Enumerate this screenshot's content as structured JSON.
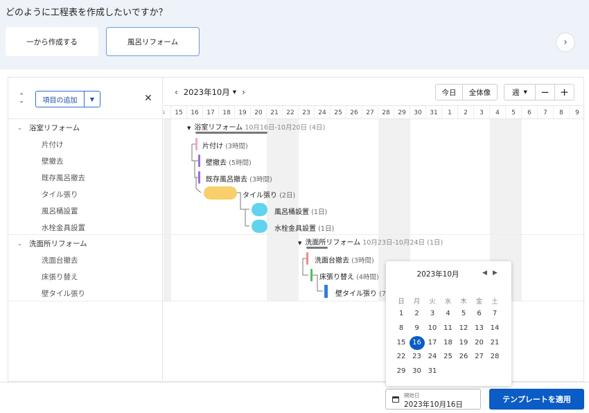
{
  "header": {
    "question": "どのように工程表を作成したいですか？",
    "templates": [
      {
        "label": "一から作成する"
      },
      {
        "label": "風呂リフォーム"
      }
    ],
    "next_icon": "chevron-right-icon"
  },
  "toolbar": {
    "add_item_label": "項目の追加",
    "month_label": "2023年10月",
    "today_label": "今日",
    "overview_label": "全体像",
    "scale_label": "週",
    "zoom_out": "−",
    "zoom_in": "+"
  },
  "days": [
    "4",
    "15",
    "16",
    "17",
    "18",
    "19",
    "20",
    "21",
    "22",
    "23",
    "24",
    "25",
    "26",
    "27",
    "28",
    "29",
    "30",
    "31",
    "1",
    "2",
    "3",
    "4",
    "5",
    "6",
    "7",
    "8",
    "9"
  ],
  "tasks": [
    {
      "name": "浴室リフォーム",
      "group": true
    },
    {
      "name": "片付け"
    },
    {
      "name": "壁撤去"
    },
    {
      "name": "既存風呂撤去"
    },
    {
      "name": "タイル張り"
    },
    {
      "name": "風呂桶設置"
    },
    {
      "name": "水栓金具設置"
    },
    {
      "name": "洗面所リフォーム",
      "group": true
    },
    {
      "name": "洗面台撤去"
    },
    {
      "name": "床張り替え"
    },
    {
      "name": "壁タイル張り"
    }
  ],
  "bars": [
    {
      "name": "浴室リフォーム",
      "range": "10月16日-10月20日",
      "dur": "(4日)"
    },
    {
      "name": "片付け",
      "dur": "(3時間)",
      "color": "#f3a6c2"
    },
    {
      "name": "壁撤去",
      "dur": "(5時間)",
      "color": "#9a6fe0"
    },
    {
      "name": "既存風呂撤去",
      "dur": "(3時間)",
      "color": "#9a6fe0"
    },
    {
      "name": "タイル張り",
      "dur": "(2日)",
      "color": "#f7cf6b"
    },
    {
      "name": "風呂桶設置",
      "dur": "(1日)",
      "color": "#62d3ee"
    },
    {
      "name": "水栓金具設置",
      "dur": "(1日)",
      "color": "#62d3ee"
    },
    {
      "name": "洗面所リフォーム",
      "range": "10月23日-10月24日",
      "dur": "(1日)"
    },
    {
      "name": "洗面台撤去",
      "dur": "(3時間)",
      "color": "#ee8a8a"
    },
    {
      "name": "床張り替え",
      "dur": "(4時間)",
      "color": "#4fbf5a"
    },
    {
      "name": "壁タイル張り",
      "dur": "(7",
      "color": "#2f7fd8"
    }
  ],
  "calendar": {
    "title": "2023年10月",
    "weekdays": [
      "日",
      "月",
      "火",
      "水",
      "木",
      "金",
      "土"
    ],
    "selected_day": "16",
    "weeks": [
      [
        "1",
        "2",
        "3",
        "4",
        "5",
        "6",
        "7"
      ],
      [
        "8",
        "9",
        "10",
        "11",
        "12",
        "13",
        "14"
      ],
      [
        "15",
        "16",
        "17",
        "18",
        "19",
        "20",
        "21"
      ],
      [
        "22",
        "23",
        "24",
        "25",
        "26",
        "27",
        "28"
      ],
      [
        "29",
        "30",
        "31",
        "",
        "",
        "",
        ""
      ]
    ]
  },
  "footer": {
    "start_label": "開始日",
    "start_value": "2023年10月16日",
    "apply_label": "テンプレートを適用"
  }
}
